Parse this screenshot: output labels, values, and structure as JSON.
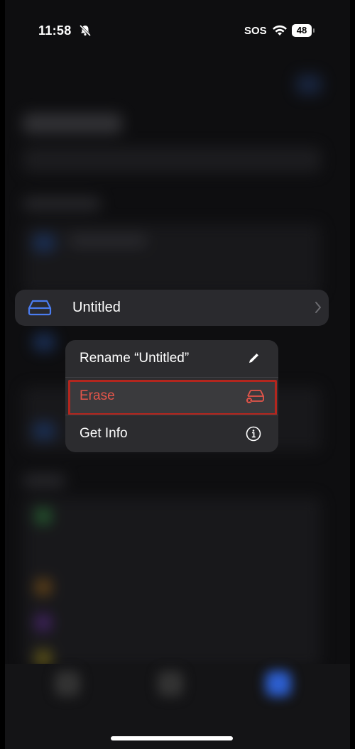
{
  "status_bar": {
    "time": "11:58",
    "signal_text": "SOS",
    "battery_level": "48",
    "icons": [
      "bell-slash-icon",
      "wifi-icon",
      "battery-icon"
    ]
  },
  "selected_row": {
    "label": "Untitled",
    "icon": "drive-icon",
    "chevron": "chevron-right-icon"
  },
  "context_menu": {
    "items": [
      {
        "label": "Rename “Untitled”",
        "icon": "pencil-icon"
      },
      {
        "label": "Erase",
        "icon": "erase-drive-icon"
      },
      {
        "label": "Get Info",
        "icon": "info-icon"
      }
    ]
  },
  "colors": {
    "accent_blue": "#4a7cf0",
    "destructive_red": "#e5554a",
    "highlight_border": "#b3261e"
  }
}
